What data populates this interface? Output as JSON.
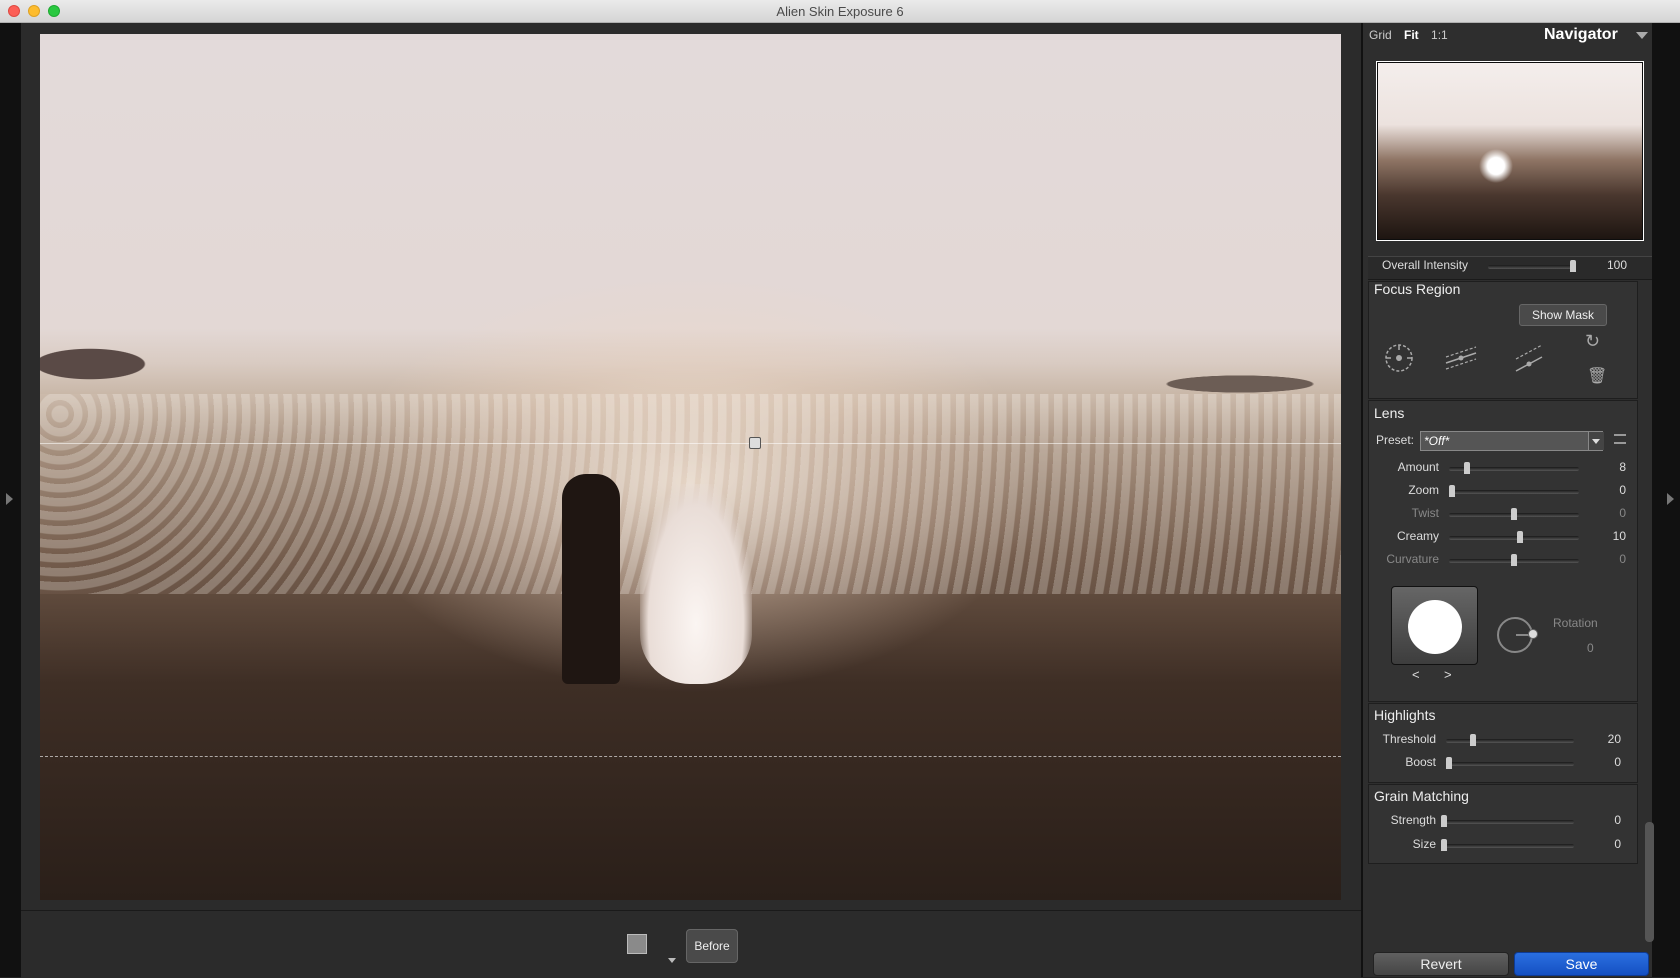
{
  "window": {
    "title": "Alien Skin Exposure 6"
  },
  "actions": {
    "before_label": "Before",
    "revert_label": "Revert",
    "save_label": "Save"
  },
  "navigator": {
    "tabs": [
      {
        "label": "Grid",
        "active": false
      },
      {
        "label": "Fit",
        "active": true
      },
      {
        "label": "1:1",
        "active": false
      }
    ],
    "title": "Navigator"
  },
  "overall_intensity": {
    "label": "Overall Intensity",
    "value": "100",
    "fraction": 1.0
  },
  "focus_region": {
    "title": "Focus Region",
    "show_mask_label": "Show Mask",
    "icons": [
      "radial-focus-icon",
      "planar-focus-icon",
      "tilt-focus-icon",
      "reset-icon",
      "trash-icon"
    ]
  },
  "lens": {
    "title": "Lens",
    "preset_label": "Preset:",
    "preset_value": "*Off*",
    "sliders": [
      {
        "label": "Amount",
        "value": "8",
        "fraction": 0.12,
        "enabled": true
      },
      {
        "label": "Zoom",
        "value": "0",
        "fraction": 0.0,
        "enabled": true
      },
      {
        "label": "Twist",
        "value": "0",
        "fraction": 0.5,
        "enabled": false
      },
      {
        "label": "Creamy",
        "value": "10",
        "fraction": 0.55,
        "enabled": true
      },
      {
        "label": "Curvature",
        "value": "0",
        "fraction": 0.5,
        "enabled": false
      }
    ],
    "bokeh_prev": "<",
    "bokeh_next": ">",
    "rotation_label": "Rotation",
    "rotation_value": "0"
  },
  "highlights": {
    "title": "Highlights",
    "sliders": [
      {
        "label": "Threshold",
        "value": "20",
        "fraction": 0.2,
        "enabled": true
      },
      {
        "label": "Boost",
        "value": "0",
        "fraction": 0.0,
        "enabled": true
      }
    ]
  },
  "grain_matching": {
    "title": "Grain Matching",
    "sliders": [
      {
        "label": "Strength",
        "value": "0",
        "fraction": 0.0,
        "enabled": true
      },
      {
        "label": "Size",
        "value": "0",
        "fraction": 0.0,
        "enabled": true
      }
    ]
  }
}
